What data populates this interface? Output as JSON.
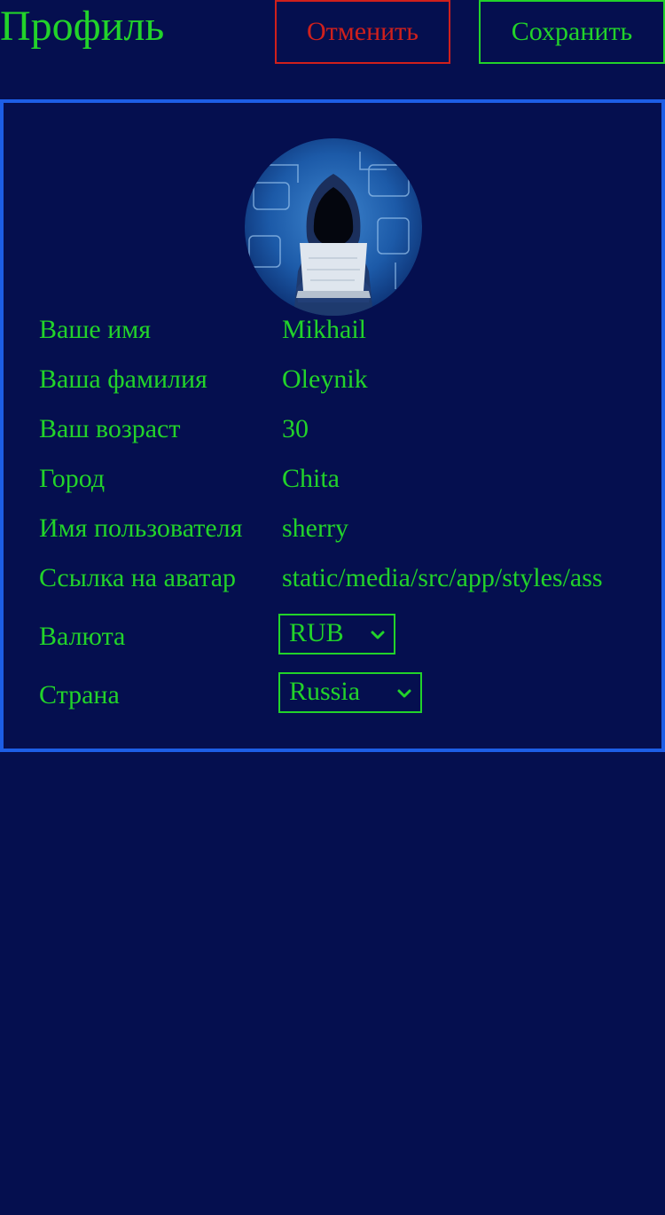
{
  "header": {
    "title": "Профиль",
    "cancel_label": "Отменить",
    "save_label": "Сохранить"
  },
  "profile": {
    "avatar_icon": "hacker-avatar-image",
    "fields": [
      {
        "label": "Ваше имя",
        "value": "Mikhail"
      },
      {
        "label": "Ваша фамилия",
        "value": "Oleynik"
      },
      {
        "label": "Ваш возраст",
        "value": "30"
      },
      {
        "label": "Город",
        "value": "Chita"
      },
      {
        "label": "Имя пользователя",
        "value": "sherry"
      },
      {
        "label": "Ссылка на аватар",
        "value": "static/media/src/app/styles/ass"
      }
    ],
    "currency": {
      "label": "Валюта",
      "selected": "RUB"
    },
    "country": {
      "label": "Страна",
      "selected": "Russia"
    }
  },
  "colors": {
    "background": "#050f4f",
    "text": "#22d32a",
    "cancel": "#d0201c",
    "card_border": "#1d5ee6"
  }
}
